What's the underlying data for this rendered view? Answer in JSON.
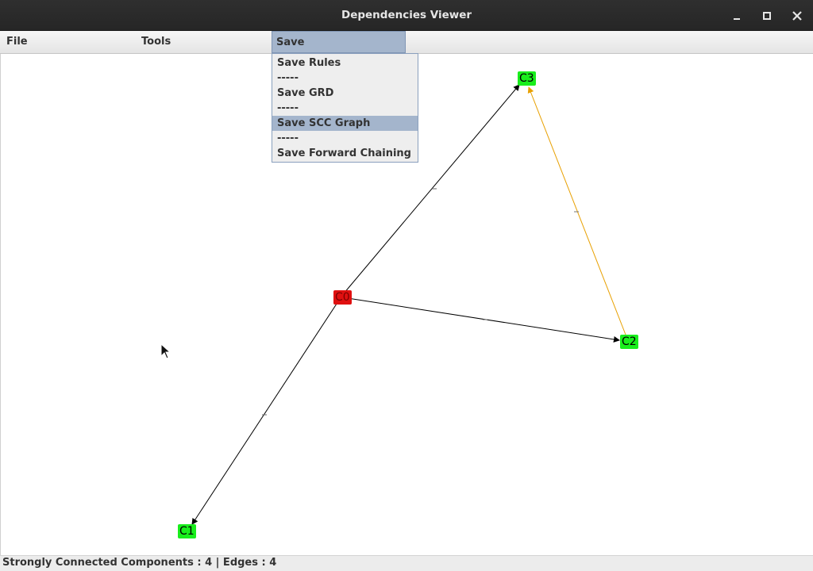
{
  "window": {
    "title": "Dependencies Viewer"
  },
  "window_controls": {
    "minimize": "minimize-icon",
    "maximize": "maximize-icon",
    "close": "close-icon"
  },
  "menubar": {
    "items": [
      {
        "label": "File"
      },
      {
        "label": "Tools"
      },
      {
        "label": "Save",
        "active": true
      }
    ]
  },
  "save_menu": {
    "items": [
      {
        "label": "Save Rules",
        "selected": false
      },
      {
        "label": "-----",
        "separator": true
      },
      {
        "label": "Save GRD",
        "selected": false
      },
      {
        "label": "-----",
        "separator": true
      },
      {
        "label": "Save SCC Graph",
        "selected": true
      },
      {
        "label": "-----",
        "separator": true
      },
      {
        "label": "Save Forward Chaining",
        "selected": false
      }
    ]
  },
  "graph": {
    "nodes": [
      {
        "id": "C0",
        "label": "C0",
        "color": "#e01010"
      },
      {
        "id": "C1",
        "label": "C1",
        "color": "#19ee1c"
      },
      {
        "id": "C2",
        "label": "C2",
        "color": "#19ee1c"
      },
      {
        "id": "C3",
        "label": "C3",
        "color": "#19ee1c"
      }
    ],
    "edges": [
      {
        "from": "C0",
        "to": "C3",
        "color": "#000000"
      },
      {
        "from": "C0",
        "to": "C1",
        "color": "#000000"
      },
      {
        "from": "C0",
        "to": "C2",
        "color": "#000000"
      },
      {
        "from": "C2",
        "to": "C3",
        "color": "#e8a000"
      }
    ]
  },
  "status": {
    "text": "Strongly Connected Components : 4 | Edges : 4"
  }
}
